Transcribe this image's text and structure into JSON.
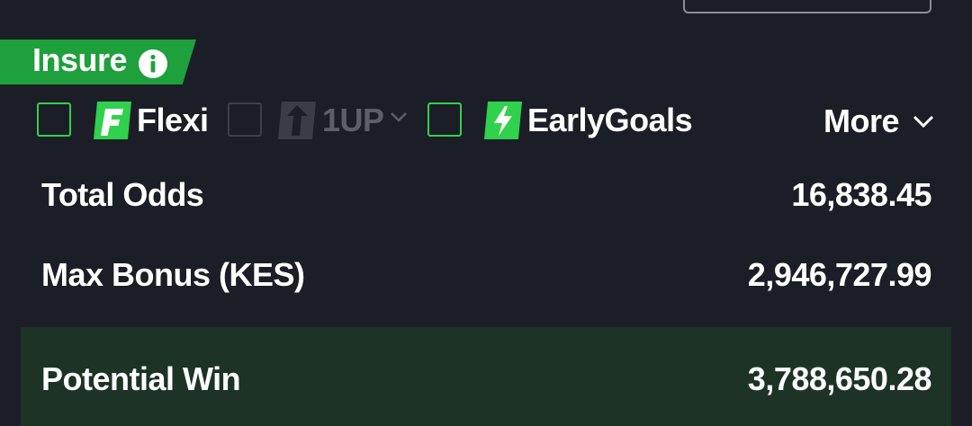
{
  "insure": {
    "label": "Insure",
    "icon": "info-icon"
  },
  "options": [
    {
      "label": "Flexi",
      "icon": "flexi-icon",
      "checked": false,
      "disabled": false
    },
    {
      "label": "1UP",
      "icon": "one-up-icon",
      "checked": false,
      "disabled": true
    },
    {
      "label": "EarlyGoals",
      "icon": "lightning-icon",
      "checked": false,
      "disabled": false
    }
  ],
  "more": {
    "label": "More",
    "icon": "chevron-down-icon"
  },
  "summary": {
    "total_odds_label": "Total Odds",
    "total_odds_value": "16,838.45",
    "max_bonus_label": "Max Bonus (KES)",
    "max_bonus_value": "2,946,727.99",
    "potential_win_label": "Potential Win",
    "potential_win_value": "3,788,650.28"
  },
  "colors": {
    "background": "#1b1e26",
    "accent_green": "#2fd14d",
    "insure_green": "#1ea03c",
    "win_panel": "#1c3326",
    "disabled": "#5b5f68"
  }
}
